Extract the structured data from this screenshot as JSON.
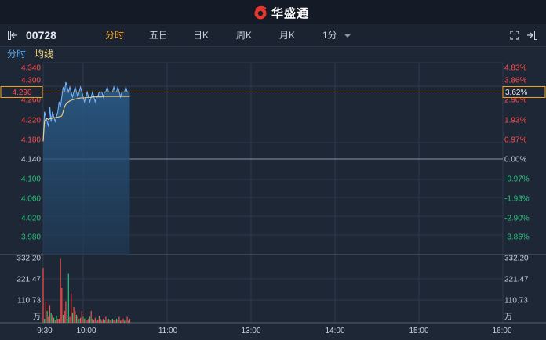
{
  "app": {
    "brand": "华盛通"
  },
  "toolbar": {
    "stock_code": "00728",
    "periods": [
      "分时",
      "五日",
      "日K",
      "周K",
      "月K",
      "1分"
    ],
    "active_period": "分时"
  },
  "chart_tabs": {
    "tab1": "分时",
    "tab2": "均线"
  },
  "colors": {
    "up": "#ff4d4d",
    "down": "#27c47c",
    "accent": "#f5a623",
    "price_line": "#6fb3ff",
    "avg_line": "#f3d27a",
    "bg": "#1e2735"
  },
  "chart_data": {
    "type": "line",
    "ref_price": 4.14,
    "current_price_label": "4.290",
    "current_pct_label": "3.62%",
    "price_ticks": [
      "4.340",
      "4.300",
      "4.260",
      "4.220",
      "4.180",
      "4.140",
      "4.100",
      "4.060",
      "4.020",
      "3.980"
    ],
    "pct_ticks": [
      "4.83%",
      "3.86%",
      "2.90%",
      "1.93%",
      "0.97%",
      "0.00%",
      "-0.97%",
      "-1.93%",
      "-2.90%",
      "-3.86%"
    ],
    "volume_ticks": [
      "332.20",
      "221.47",
      "110.73",
      "万"
    ],
    "time_ticks": [
      "9:30",
      "10:00",
      "11:00",
      "13:00",
      "14:00",
      "15:00",
      "16:00"
    ],
    "price_ylim": [
      3.96,
      4.34
    ],
    "volume_ylim": [
      0,
      332.2
    ],
    "price": [
      4.19,
      4.25,
      4.24,
      4.23,
      4.22,
      4.26,
      4.23,
      4.25,
      4.24,
      4.23,
      4.24,
      4.25,
      4.27,
      4.26,
      4.28,
      4.3,
      4.29,
      4.31,
      4.3,
      4.29,
      4.3,
      4.29,
      4.28,
      4.29,
      4.3,
      4.29,
      4.28,
      4.29,
      4.3,
      4.29,
      4.28,
      4.27,
      4.28,
      4.29,
      4.28,
      4.27,
      4.28,
      4.29,
      4.28,
      4.27,
      4.28,
      4.28,
      4.29,
      4.29,
      4.29,
      4.28,
      4.29,
      4.29,
      4.3,
      4.29,
      4.29,
      4.29,
      4.29,
      4.3,
      4.29,
      4.29,
      4.3,
      4.29,
      4.28,
      4.29,
      4.29,
      4.29,
      4.3,
      4.29,
      4.29,
      4.29
    ],
    "avg": [
      4.19,
      4.23,
      4.235,
      4.236,
      4.234,
      4.236,
      4.236,
      4.237,
      4.238,
      4.238,
      4.238,
      4.239,
      4.24,
      4.24,
      4.242,
      4.25,
      4.26,
      4.265,
      4.268,
      4.27,
      4.272,
      4.273,
      4.274,
      4.275,
      4.276,
      4.276,
      4.277,
      4.277,
      4.278,
      4.278,
      4.278,
      4.278,
      4.279,
      4.279,
      4.279,
      4.279,
      4.279,
      4.28,
      4.28,
      4.28,
      4.28,
      4.28,
      4.28,
      4.28,
      4.28,
      4.281,
      4.281,
      4.281,
      4.281,
      4.281,
      4.281,
      4.281,
      4.281,
      4.281,
      4.281,
      4.281,
      4.281,
      4.281,
      4.281,
      4.281,
      4.281,
      4.281,
      4.281,
      4.281,
      4.281,
      4.281
    ],
    "volume": [
      280,
      20,
      110,
      60,
      30,
      90,
      50,
      40,
      25,
      15,
      35,
      20,
      20,
      330,
      180,
      40,
      60,
      110,
      20,
      250,
      30,
      150,
      50,
      80,
      60,
      40,
      30,
      20,
      25,
      60,
      30,
      20,
      25,
      15,
      20,
      30,
      60,
      20,
      15,
      25,
      10,
      15,
      35,
      20,
      10,
      20,
      15,
      30,
      10,
      20,
      15,
      10,
      20,
      15,
      10,
      20,
      15,
      30,
      10,
      15,
      20,
      10,
      15,
      30,
      10,
      20
    ],
    "volume_up": [
      true,
      false,
      true,
      false,
      true,
      true,
      false,
      true,
      false,
      true,
      false,
      true,
      true,
      true,
      true,
      false,
      true,
      true,
      false,
      false,
      true,
      true,
      false,
      true,
      true,
      false,
      true,
      false,
      true,
      true,
      false,
      true,
      false,
      true,
      true,
      false,
      true,
      false,
      true,
      true,
      false,
      true,
      true,
      false,
      true,
      true,
      false,
      true,
      true,
      false,
      true,
      true,
      false,
      true,
      true,
      false,
      true,
      true,
      false,
      true,
      true,
      false,
      true,
      true,
      false,
      true
    ]
  }
}
